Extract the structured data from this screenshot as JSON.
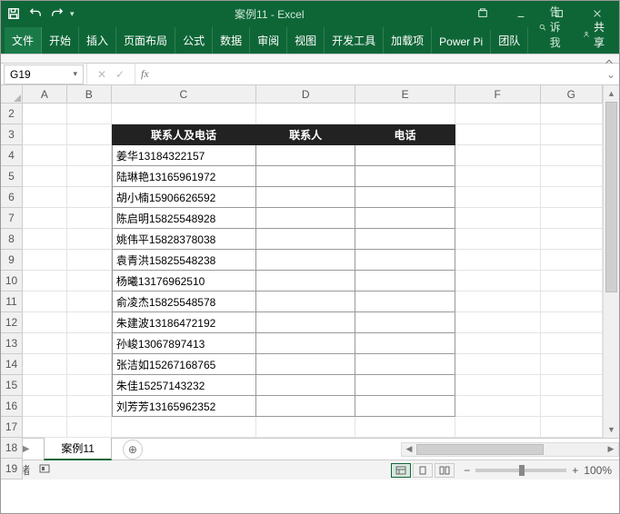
{
  "titlebar": {
    "title": "案例11 - Excel"
  },
  "tabs": {
    "file": "文件",
    "home": "开始",
    "insert": "插入",
    "layout": "页面布局",
    "formulas": "公式",
    "data": "数据",
    "review": "审阅",
    "view": "视图",
    "developer": "开发工具",
    "addins": "加载项",
    "powerpivot": "Power Pi",
    "team": "团队"
  },
  "tellme": "告诉我",
  "share": "共享",
  "namebox": "G19",
  "columns": [
    "A",
    "B",
    "C",
    "D",
    "E",
    "F",
    "G"
  ],
  "row_start": 2,
  "row_end": 19,
  "header_row": {
    "c": "联系人及电话",
    "d": "联系人",
    "e": "电话"
  },
  "data_rows": [
    {
      "c": "姜华13184322157"
    },
    {
      "c": "陆琳艳13165961972"
    },
    {
      "c": "胡小楠15906626592"
    },
    {
      "c": "陈启明15825548928"
    },
    {
      "c": "姚伟平15828378038"
    },
    {
      "c": "袁青洪15825548238"
    },
    {
      "c": "杨曦13176962510"
    },
    {
      "c": "俞凌杰15825548578"
    },
    {
      "c": "朱建波13186472192"
    },
    {
      "c": "孙峻13067897413"
    },
    {
      "c": "张洁如15267168765"
    },
    {
      "c": "朱佳15257143232"
    },
    {
      "c": "刘芳芳13165962352"
    }
  ],
  "sheet_tab": "案例11",
  "status": {
    "ready": "就绪",
    "zoom": "100%",
    "minus": "−",
    "plus": "+"
  }
}
